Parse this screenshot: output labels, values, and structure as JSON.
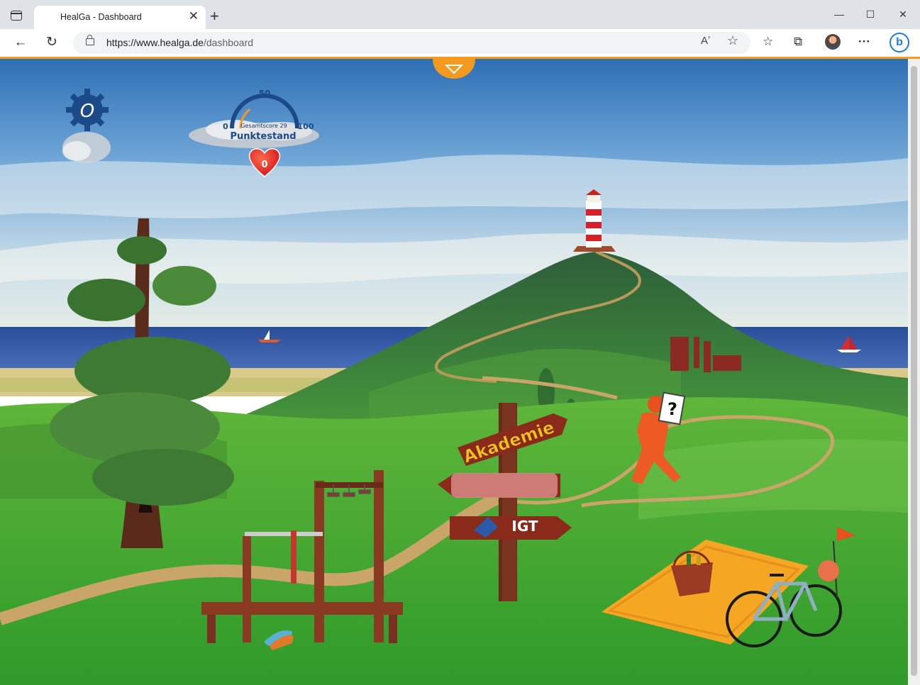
{
  "browser": {
    "tab_title": "HealGa - Dashboard",
    "tab_close": "✕",
    "new_tab": "+",
    "url_host": "https://www.healga.de",
    "url_path": "/dashboard",
    "window": {
      "minimize": "—",
      "maximize": "☐",
      "close": "✕"
    },
    "nav": {
      "back": "←",
      "reload": "↻"
    },
    "addr_icons": {
      "read_aloud": "Aʼ",
      "favorite_add": "☆"
    },
    "toolbar_icons": {
      "favorites": "☆",
      "collections": "⧉",
      "more": "···",
      "copilot": "b"
    }
  },
  "hud": {
    "gauge": {
      "min_label": "0",
      "mid_label": "50",
      "max_label": "100",
      "score_label": "Gesamtscore 29",
      "score_value": 29,
      "title": "Punktestand"
    },
    "heart_count": "0",
    "settings_letter": "O"
  },
  "signpost": {
    "top": "Akademie",
    "bottom": "IGT"
  },
  "quiz_marker": "?",
  "colors": {
    "accent_orange": "#f49a1f",
    "heart_red": "#e8201e",
    "sign_brown": "#7a2a1a",
    "sign_text": "#f2c21d"
  }
}
